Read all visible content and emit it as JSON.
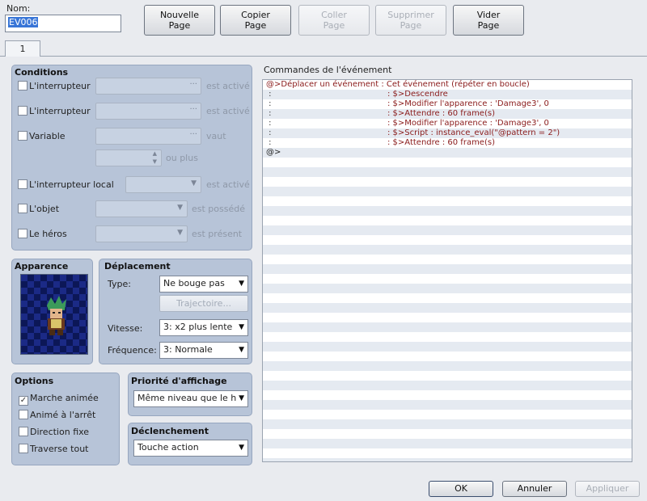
{
  "name": {
    "label": "Nom:",
    "value": "EV006"
  },
  "top_buttons": [
    {
      "line1": "Nouvelle",
      "line2": "Page",
      "enabled": true
    },
    {
      "line1": "Copier",
      "line2": "Page",
      "enabled": true
    },
    {
      "line1": "Coller",
      "line2": "Page",
      "enabled": false
    },
    {
      "line1": "Supprimer",
      "line2": "Page",
      "enabled": false
    },
    {
      "line1": "Vider",
      "line2": "Page",
      "enabled": true
    }
  ],
  "tab": {
    "label": "1"
  },
  "conditions": {
    "title": "Conditions",
    "switch1": {
      "label": "L'interrupteur",
      "hint": "est activé"
    },
    "switch2": {
      "label": "L'interrupteur",
      "hint": "est activé"
    },
    "variable": {
      "label": "Variable",
      "hint": "vaut",
      "hint2": "ou plus"
    },
    "self_switch": {
      "label": "L'interrupteur local",
      "hint": "est activé"
    },
    "item": {
      "label": "L'objet",
      "hint": "est possédé"
    },
    "actor": {
      "label": "Le héros",
      "hint": "est présent"
    }
  },
  "appearance": {
    "title": "Apparence"
  },
  "movement": {
    "title": "Déplacement",
    "type_label": "Type:",
    "type_value": "Ne bouge pas",
    "route_button": "Trajectoire...",
    "speed_label": "Vitesse:",
    "speed_value": "3: x2 plus lente",
    "freq_label": "Fréquence:",
    "freq_value": "3: Normale"
  },
  "options": {
    "title": "Options",
    "walk_anim": {
      "label": "Marche animée",
      "checked": true
    },
    "step_anim": {
      "label": "Animé à l'arrêt",
      "checked": false
    },
    "dir_fix": {
      "label": "Direction fixe",
      "checked": false
    },
    "through": {
      "label": "Traverse tout",
      "checked": false
    }
  },
  "priority": {
    "title": "Priorité d'affichage",
    "value": "Même niveau que le h"
  },
  "trigger": {
    "title": "Déclenchement",
    "value": "Touche action"
  },
  "commands": {
    "title": "Commandes de l'événement",
    "lines": [
      {
        "c1": "@>Déplacer un événement : Cet événement (répéter en boucle)",
        "c2": ""
      },
      {
        "c1": " :",
        "c2": ": $>Descendre"
      },
      {
        "c1": " :",
        "c2": ": $>Modifier l'apparence : 'Damage3', 0"
      },
      {
        "c1": " :",
        "c2": ": $>Attendre : 60 frame(s)"
      },
      {
        "c1": " :",
        "c2": ": $>Modifier l'apparence : 'Damage3', 0"
      },
      {
        "c1": " :",
        "c2": ": $>Script : instance_eval(\"@pattern = 2\")"
      },
      {
        "c1": " :",
        "c2": ": $>Attendre : 60 frame(s)"
      },
      {
        "c1": "@>",
        "c2": ""
      }
    ]
  },
  "bottom_buttons": {
    "ok": "OK",
    "cancel": "Annuler",
    "apply": "Appliquer"
  }
}
